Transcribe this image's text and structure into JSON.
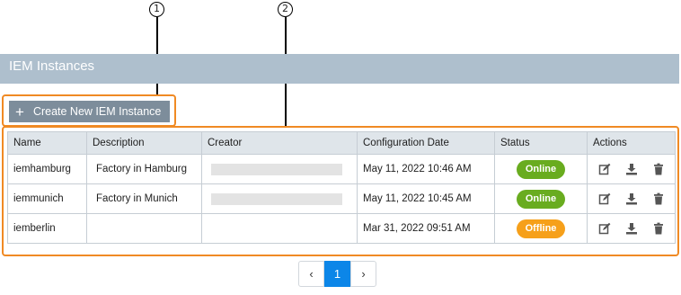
{
  "callouts": {
    "one": "1",
    "two": "2"
  },
  "header": {
    "title": "IEM Instances"
  },
  "create_button": {
    "icon": "plus-icon",
    "label": "Create New IEM Instance"
  },
  "table": {
    "columns": [
      "Name",
      "Description",
      "Creator",
      "Configuration Date",
      "Status",
      "Actions"
    ],
    "rows": [
      {
        "name": "iemhamburg",
        "description": "Factory in Hamburg",
        "creator_redacted": true,
        "date": "May 11, 2022 10:46 AM",
        "status": "Online"
      },
      {
        "name": "iemmunich",
        "description": "Factory in Munich",
        "creator_redacted": true,
        "date": "May 11, 2022 10:45 AM",
        "status": "Online"
      },
      {
        "name": "iemberlin",
        "description": "",
        "creator_redacted": false,
        "date": "Mar 31, 2022 09:51 AM",
        "status": "Offline"
      }
    ],
    "action_icons": [
      "edit-icon",
      "download-icon",
      "trash-icon"
    ]
  },
  "pagination": {
    "prev": "‹",
    "current": "1",
    "next": "›"
  },
  "colors": {
    "header": "#aebfcd",
    "button": "#7d8d9b",
    "highlight": "#f08a24",
    "online": "#69ac1f",
    "offline": "#f6a01a",
    "page_active": "#0c86e8"
  }
}
